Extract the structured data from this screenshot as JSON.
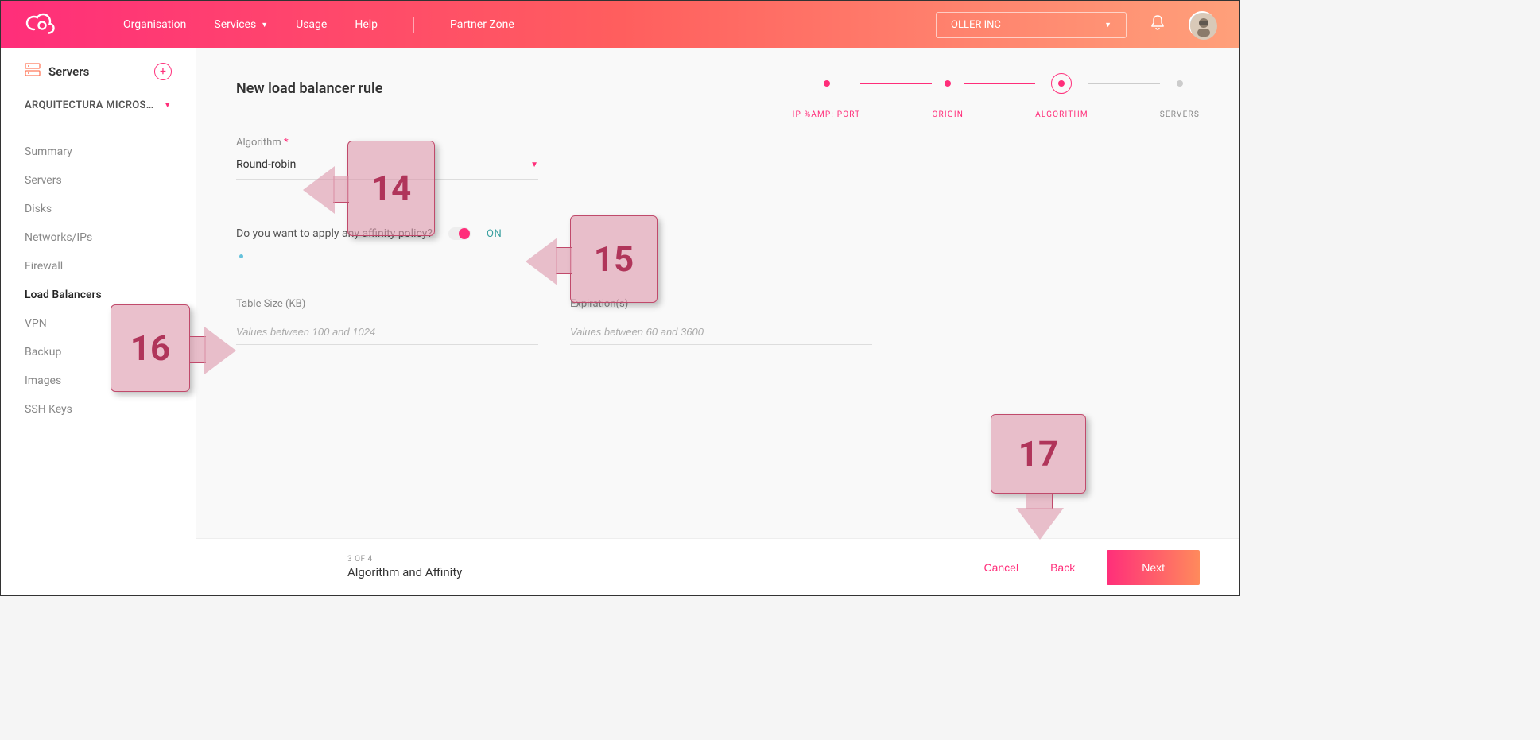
{
  "header": {
    "nav": {
      "organisation": "Organisation",
      "services": "Services",
      "usage": "Usage",
      "help": "Help",
      "partner": "Partner Zone"
    },
    "org_select": "OLLER INC"
  },
  "sidebar": {
    "title": "Servers",
    "project": "ARQUITECTURA MICROS…",
    "items": {
      "summary": "Summary",
      "servers": "Servers",
      "disks": "Disks",
      "networks": "Networks/IPs",
      "firewall": "Firewall",
      "loadbalancers": "Load Balancers",
      "vpn": "VPN",
      "backup": "Backup",
      "images": "Images",
      "sshkeys": "SSH Keys"
    }
  },
  "stepper": {
    "s1": "IP %AMP: PORT",
    "s2": "ORIGIN",
    "s3": "ALGORITHM",
    "s4": "SERVERS"
  },
  "form": {
    "title": "New load balancer rule",
    "algorithm_label": "Algorithm",
    "algorithm_value": "Round-robin",
    "affinity_question": "Do you want to apply any affinity policy?",
    "on_label": "ON",
    "tablesize_label": "Table Size (KB)",
    "tablesize_placeholder": "Values between 100 and 1024",
    "expiration_label": "Expiration(s)",
    "expiration_placeholder": "Values between 60 and 3600"
  },
  "footer": {
    "step": "3 OF 4",
    "title": "Algorithm and Affinity",
    "cancel": "Cancel",
    "back": "Back",
    "next": "Next"
  },
  "callouts": {
    "c14": "14",
    "c15": "15",
    "c16": "16",
    "c17": "17"
  }
}
